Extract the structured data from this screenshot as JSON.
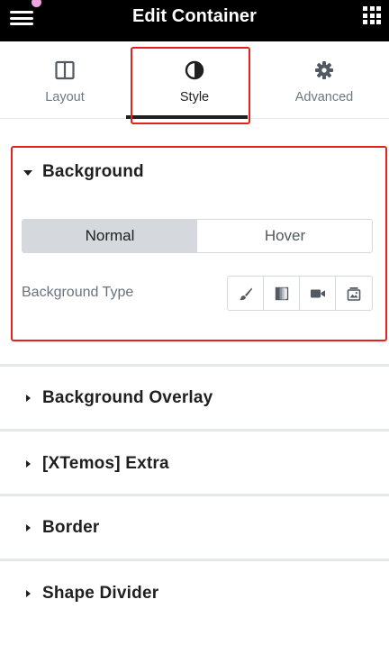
{
  "header": {
    "title": "Edit Container"
  },
  "tabs": [
    {
      "label": "Layout",
      "icon": "columns-icon"
    },
    {
      "label": "Style",
      "icon": "half-circle-icon"
    },
    {
      "label": "Advanced",
      "icon": "gear-icon"
    }
  ],
  "background": {
    "title": "Background",
    "state_toggle": [
      "Normal",
      "Hover"
    ],
    "selected_state": "Normal",
    "type_label": "Background Type",
    "type_options": [
      "brush-icon",
      "gradient-icon",
      "video-icon",
      "slideshow-icon"
    ]
  },
  "sections": [
    {
      "title": "Background Overlay"
    },
    {
      "title": "[XTemos] Extra"
    },
    {
      "title": "Border"
    },
    {
      "title": "Shape Divider"
    }
  ],
  "colors": {
    "highlight": "#e3211d",
    "header_bg": "#000000",
    "toggle_active": "#d5d8dc"
  }
}
